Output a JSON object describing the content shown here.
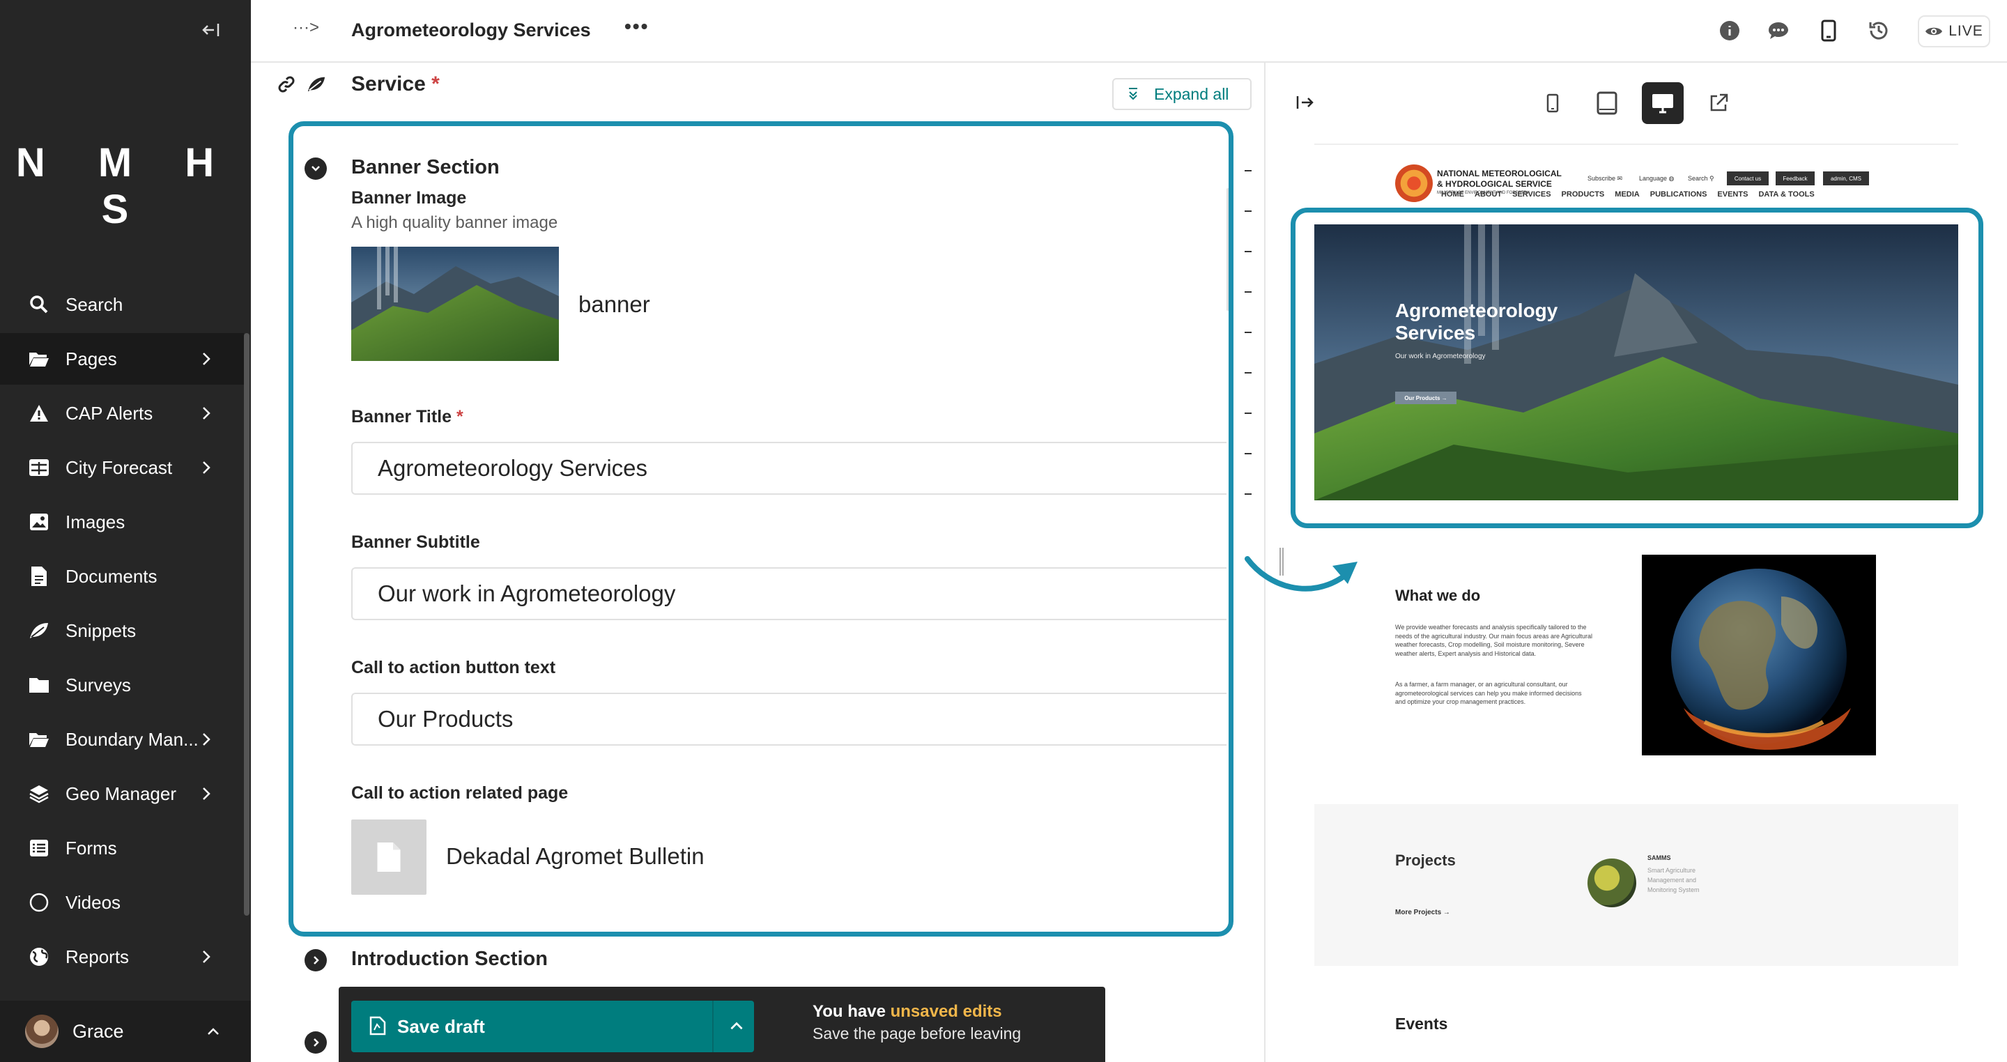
{
  "sidebar": {
    "logo": "N M H S",
    "items": [
      {
        "label": "Search",
        "icon": "search-icon"
      },
      {
        "label": "Pages",
        "icon": "folder-open-icon"
      },
      {
        "label": "CAP Alerts",
        "icon": "warning-icon"
      },
      {
        "label": "City Forecast",
        "icon": "table-icon"
      },
      {
        "label": "Images",
        "icon": "image-icon"
      },
      {
        "label": "Documents",
        "icon": "document-icon"
      },
      {
        "label": "Snippets",
        "icon": "snippet-icon"
      },
      {
        "label": "Surveys",
        "icon": "folder-icon"
      },
      {
        "label": "Boundary Man...",
        "icon": "folder-open-icon"
      },
      {
        "label": "Geo Manager",
        "icon": "layers-icon"
      },
      {
        "label": "Forms",
        "icon": "list-icon"
      },
      {
        "label": "Videos",
        "icon": "circle-icon"
      },
      {
        "label": "Reports",
        "icon": "globe-icon"
      }
    ],
    "user": "Grace"
  },
  "header": {
    "breadcrumb": "···>",
    "title": "Agrometeorology Services",
    "more": "•••",
    "live_label": "LIVE"
  },
  "editor": {
    "field_title": "Service",
    "required_mark": "*",
    "expand_all": "Expand all",
    "banner_section": "Banner Section",
    "banner_image_label": "Banner Image",
    "banner_image_help": "A high quality banner image",
    "banner_image_name": "banner",
    "banner_title_label": "Banner Title",
    "banner_title_value": "Agrometeorology Services",
    "banner_subtitle_label": "Banner Subtitle",
    "banner_subtitle_value": "Our work in Agrometeorology",
    "cta_text_label": "Call to action button text",
    "cta_text_value": "Our Products",
    "cta_page_label": "Call to action related page",
    "cta_page_value": "Dekadal Agromet Bulletin",
    "intro_section": "Introduction Section"
  },
  "savebar": {
    "save_label": "Save draft",
    "unsaved_prefix": "You have ",
    "unsaved_highlight": "unsaved edits",
    "unsaved_sub": "Save the page before leaving"
  },
  "preview_site": {
    "org_line1": "NATIONAL METEOROLOGICAL",
    "org_line2": "& HYDROLOGICAL SERVICE",
    "ministry": "MINISTRY OF ENVIRONMENT AND FORESTRY",
    "subscribe": "Subscribe ✉",
    "language": "Language ◍",
    "search": "Search ⚲",
    "contact": "Contact us",
    "feedback": "Feedback",
    "admin": "admin, CMS",
    "menu": [
      "HOME",
      "ABOUT",
      "SERVICES",
      "PRODUCTS",
      "MEDIA",
      "PUBLICATIONS",
      "EVENTS",
      "DATA & TOOLS"
    ],
    "hero_title": "Agrometeorology Services",
    "hero_sub": "Our work in Agrometeorology",
    "hero_btn": "Our Products →",
    "wwd_title": "What we do",
    "wwd_p1": "We provide weather forecasts and analysis specifically tailored to the needs of the agricultural industry. Our main focus areas are Agricultural weather forecasts, Crop modelling, Soil moisture monitoring, Severe weather alerts, Expert analysis and Historical data.",
    "wwd_p2": "As a farmer, a farm manager, or an agricultural consultant, our agrometeorological services can help you make informed decisions and optimize your crop management practices.",
    "projects_title": "Projects",
    "project_name": "SAMMS",
    "project_desc": "Smart Agriculture Management and Monitoring System",
    "more_projects": "More Projects →",
    "events_title": "Events"
  },
  "colors": {
    "accent": "#007d7e",
    "highlight_border": "#1c8fae",
    "sidebar_bg": "#262626",
    "warning": "#f0b64a"
  }
}
